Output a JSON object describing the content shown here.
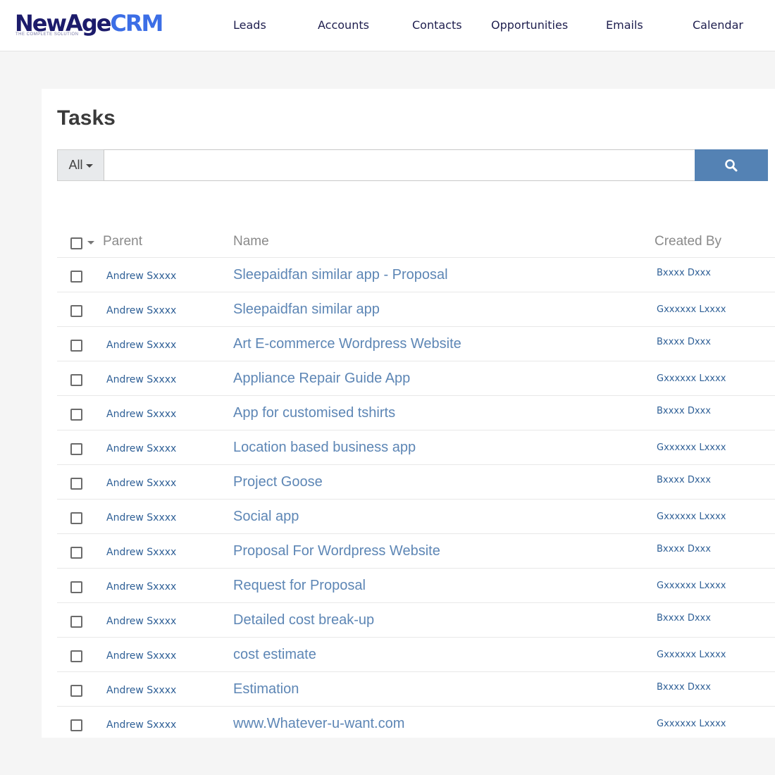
{
  "brand": {
    "part1": "NewAge",
    "part2": "CRM",
    "tagline": "THE COMPLETE SOLUTION"
  },
  "nav": [
    "Leads",
    "Accounts",
    "Contacts",
    "Opportunities",
    "Emails",
    "Calendar"
  ],
  "page": {
    "title": "Tasks"
  },
  "search": {
    "filter_label": "All",
    "value": "",
    "placeholder": "",
    "button_icon": "search-icon"
  },
  "table": {
    "columns": {
      "parent": "Parent",
      "name": "Name",
      "created_by": "Created By"
    },
    "rows": [
      {
        "parent": "Andrew Sxxxx",
        "name": "Sleepaidfan similar app - Proposal",
        "created_by": "Bxxxx Dxxx"
      },
      {
        "parent": "Andrew Sxxxx",
        "name": "Sleepaidfan similar app",
        "created_by": "Gxxxxxx Lxxxx"
      },
      {
        "parent": "Andrew Sxxxx",
        "name": "Art E-commerce Wordpress Website",
        "created_by": "Bxxxx Dxxx"
      },
      {
        "parent": "Andrew Sxxxx",
        "name": "Appliance Repair Guide App",
        "created_by": "Gxxxxxx Lxxxx"
      },
      {
        "parent": "Andrew Sxxxx",
        "name": "App for customised tshirts",
        "created_by": "Bxxxx Dxxx"
      },
      {
        "parent": "Andrew Sxxxx",
        "name": "Location based business app",
        "created_by": "Gxxxxxx Lxxxx"
      },
      {
        "parent": "Andrew Sxxxx",
        "name": "Project Goose",
        "created_by": "Bxxxx Dxxx"
      },
      {
        "parent": "Andrew Sxxxx",
        "name": "Social app",
        "created_by": "Gxxxxxx Lxxxx"
      },
      {
        "parent": "Andrew Sxxxx",
        "name": "Proposal For Wordpress Website",
        "created_by": "Bxxxx Dxxx"
      },
      {
        "parent": "Andrew Sxxxx",
        "name": "Request for Proposal",
        "created_by": "Gxxxxxx Lxxxx"
      },
      {
        "parent": "Andrew Sxxxx",
        "name": "Detailed cost break-up",
        "created_by": "Bxxxx Dxxx"
      },
      {
        "parent": "Andrew Sxxxx",
        "name": "cost estimate",
        "created_by": "Gxxxxxx Lxxxx"
      },
      {
        "parent": "Andrew Sxxxx",
        "name": "Estimation",
        "created_by": "Bxxxx Dxxx"
      },
      {
        "parent": "Andrew Sxxxx",
        "name": "www.Whatever-u-want.com",
        "created_by": "Gxxxxxx Lxxxx"
      }
    ]
  },
  "colors": {
    "brand_dark": "#1c1b6b",
    "brand_accent": "#3c6ee6",
    "link": "#2e5f96",
    "search_button": "#5482b4"
  }
}
